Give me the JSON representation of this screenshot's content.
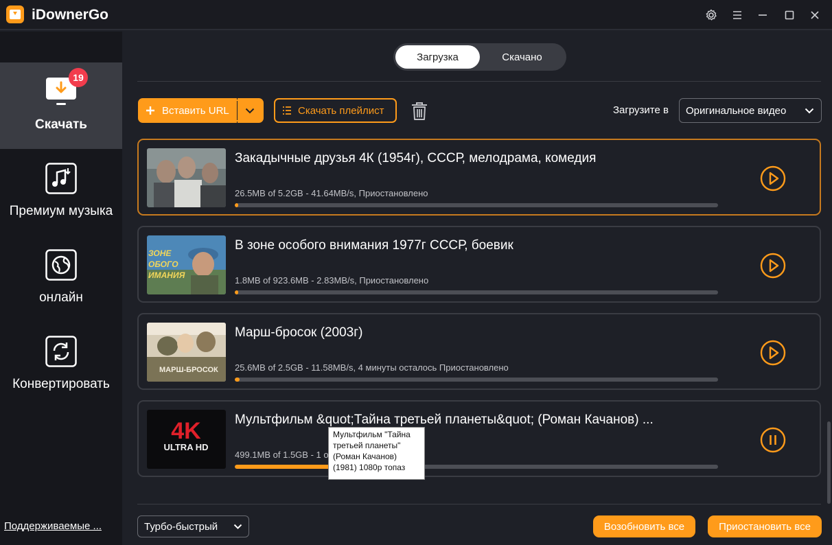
{
  "app": {
    "title": "iDownerGo"
  },
  "colors": {
    "accent": "#ff9b1a",
    "badge": "#f23c4d",
    "sidebar_bg": "#16171c",
    "main_bg": "#1e2027"
  },
  "sidebar": {
    "items": [
      {
        "label": "Скачать",
        "icon": "download-monitor-icon",
        "badge": "19",
        "active": true
      },
      {
        "label": "Премиум музыка",
        "icon": "music-note-icon"
      },
      {
        "label": "онлайн",
        "icon": "globe-icon"
      },
      {
        "label": "Конвертировать",
        "icon": "convert-icon"
      }
    ],
    "supported_link": "Поддерживаемые ..."
  },
  "tabs": [
    {
      "label": "Загрузка",
      "active": true
    },
    {
      "label": "Скачано",
      "active": false
    }
  ],
  "toolbar": {
    "paste_url": "Вставить URL",
    "download_playlist": "Скачать плейлист",
    "download_to_label": "Загрузите в",
    "download_to_value": "Оригинальное видео"
  },
  "downloads": [
    {
      "title": "Закадычные друзья 4К (1954г), СССР, мелодрама, комедия",
      "meta": "26.5MB of 5.2GB -   41.64MB/s,  Приостановлено",
      "progress": 0.005,
      "state": "paused"
    },
    {
      "title": "В зоне особого внимания 1977г СССР, боевик",
      "meta": "1.8MB of 923.6MB -   2.83MB/s,  Приостановлено",
      "progress": 0.002,
      "state": "paused"
    },
    {
      "title": "Марш-бросок (2003г)",
      "meta": "25.6MB of 2.5GB -   11.58MB/s, 4 минуты осталось Приостановлено",
      "progress": 0.01,
      "state": "paused"
    },
    {
      "title": "Мультфильм &quot;Тайна третьей планеты&quot; (Роман Качанов) ...",
      "meta": "499.1MB of 1.5GB -   1                                   осталось",
      "progress": 0.32,
      "state": "downloading"
    }
  ],
  "thumb_text": {
    "zone_line1": "ЗОНЕ",
    "zone_line2": "ОБОГО",
    "zone_line3": "ИМАНИЯ",
    "march": "МАРШ-БРОСОК",
    "fourk": "4K",
    "ultra": "ULTRA HD"
  },
  "tooltip": {
    "text": "Мультфильм \"Тайна третьей планеты\" (Роман Качанов) (1981) 1080p топаз"
  },
  "footer": {
    "speed_value": "Турбо-быстрый",
    "resume_all": "Возобновить все",
    "pause_all": "Приостановить все"
  }
}
